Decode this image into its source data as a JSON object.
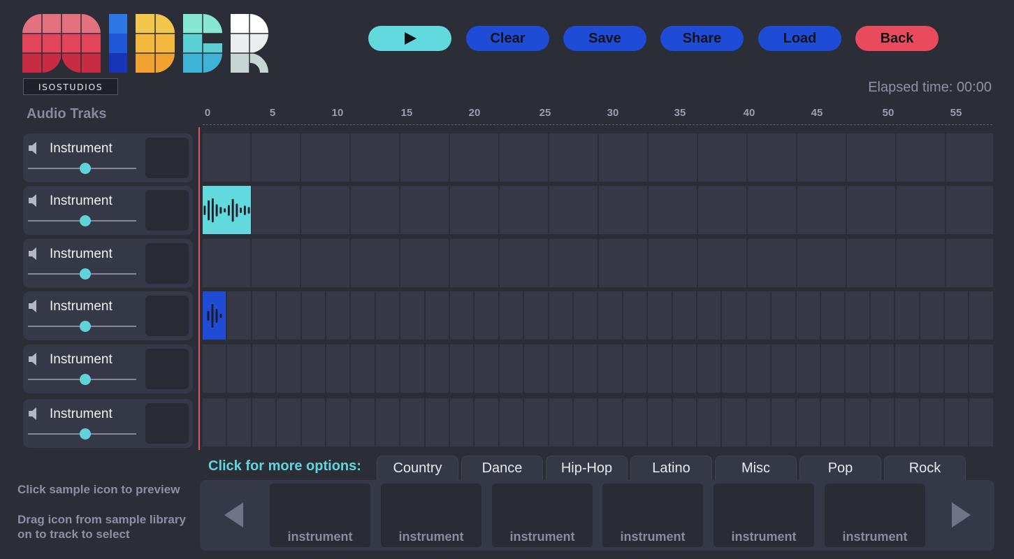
{
  "brand": {
    "tag": "ISOSTUDIOS"
  },
  "toolbar": {
    "play_label": "",
    "clear_label": "Clear",
    "save_label": "Save",
    "share_label": "Share",
    "load_label": "Load",
    "back_label": "Back"
  },
  "elapsed": {
    "label": "Elapsed time: ",
    "value": "00:00"
  },
  "timeline": {
    "title": "Audio Traks",
    "ticks": [
      "0",
      "5",
      "10",
      "15",
      "20",
      "25",
      "30",
      "35",
      "40",
      "45",
      "50",
      "55"
    ]
  },
  "tracks": [
    {
      "name": "Instrument",
      "volume": 0.53
    },
    {
      "name": "Instrument",
      "volume": 0.53
    },
    {
      "name": "Instrument",
      "volume": 0.53
    },
    {
      "name": "Instrument",
      "volume": 0.53
    },
    {
      "name": "Instrument",
      "volume": 0.53
    },
    {
      "name": "Instrument",
      "volume": 0.53
    }
  ],
  "help": {
    "preview": "Click sample icon to preview",
    "drag_line1": "Drag icon from sample library",
    "drag_line2": "on to track to select"
  },
  "library": {
    "more_label": "Click for more options:",
    "tabs": [
      "Country",
      "Dance",
      "Hip-Hop",
      "Latino",
      "Misc",
      "Pop",
      "Rock"
    ],
    "samples": [
      "instrument",
      "instrument",
      "instrument",
      "instrument",
      "instrument",
      "instrument"
    ]
  },
  "colors": {
    "accent_cyan": "#62d9dd",
    "accent_blue": "#1e4cd6",
    "accent_red": "#e94b5d",
    "background": "#2b2d37"
  }
}
